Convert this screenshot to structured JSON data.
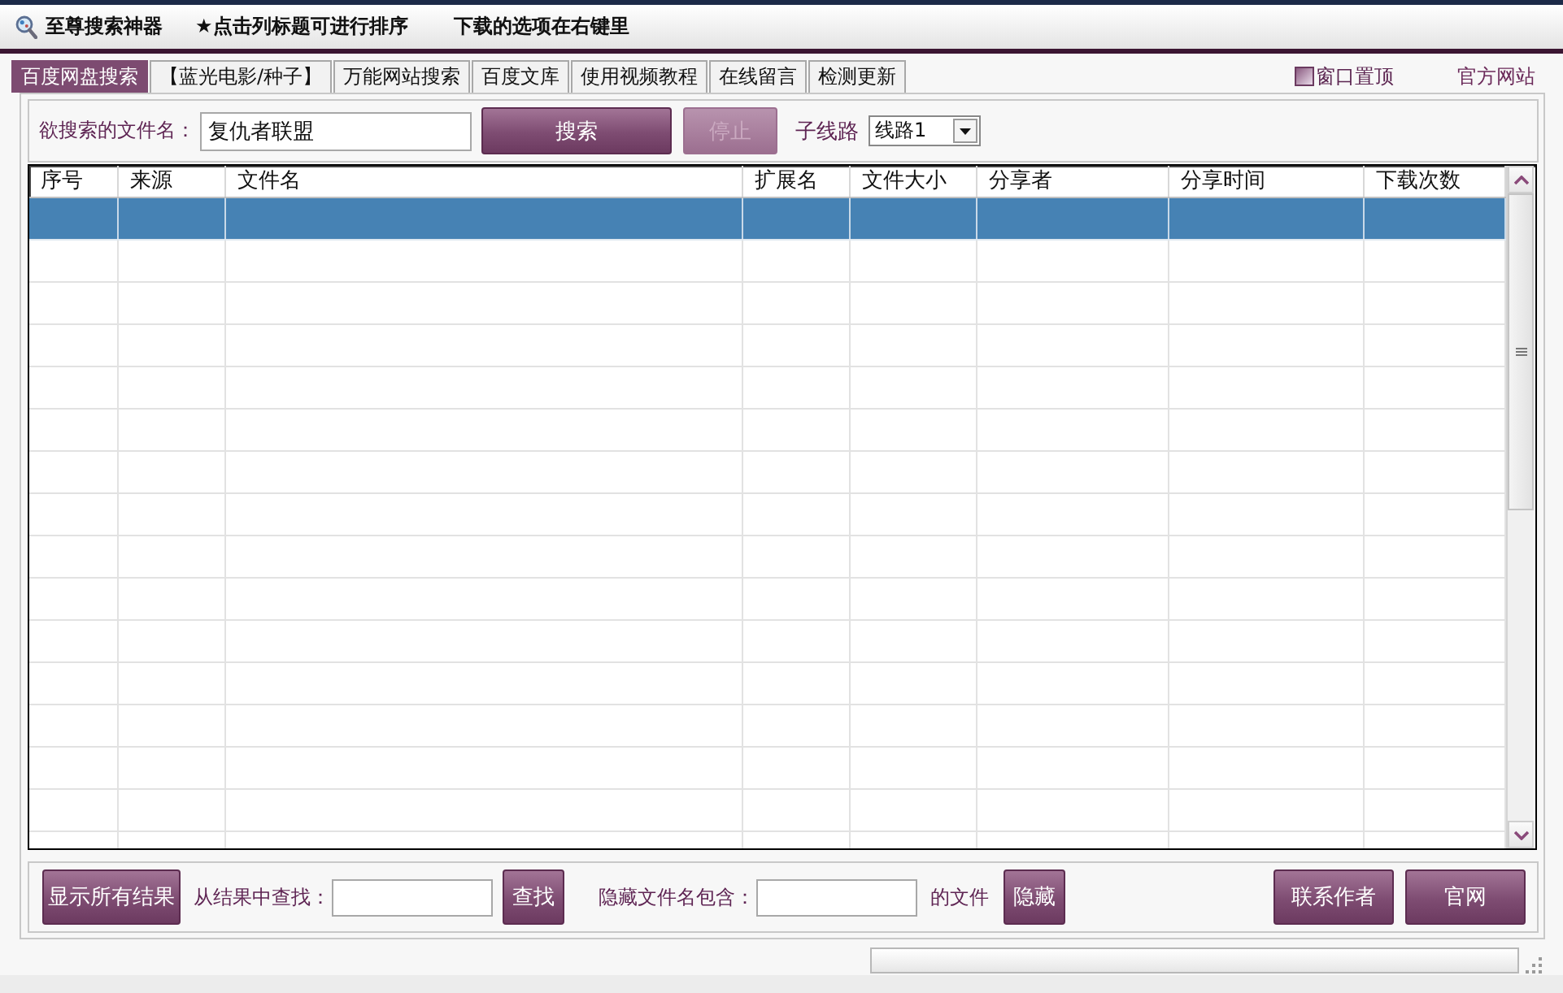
{
  "title_bar": {
    "title": "至尊搜索神器",
    "hints": [
      "★点击列标题可进行排序",
      "下载的选项在右键里"
    ]
  },
  "tabs": [
    {
      "label": "百度网盘搜索",
      "selected": true
    },
    {
      "label": "【蓝光电影/种子】",
      "selected": false
    },
    {
      "label": "万能网站搜索",
      "selected": false
    },
    {
      "label": "百度文库",
      "selected": false
    },
    {
      "label": "使用视频教程",
      "selected": false
    },
    {
      "label": "在线留言",
      "selected": false
    },
    {
      "label": "检测更新",
      "selected": false
    }
  ],
  "stay_on_top": {
    "label": "窗口置顶",
    "checked": false
  },
  "official_site_link": "官方网站",
  "search_panel": {
    "label": "欲搜索的文件名：",
    "value": "复仇者联盟",
    "buttons": [
      {
        "label": "搜索",
        "disabled": false
      },
      {
        "label": "停止",
        "disabled": true
      }
    ],
    "route_label": "子线路",
    "route_value": "线路1"
  },
  "table": {
    "columns": [
      "序号",
      "来源",
      "文件名",
      "扩展名",
      "文件大小",
      "分享者",
      "分享时间",
      "下载次数"
    ],
    "rows": [
      {
        "selected": true
      },
      {
        "selected": false
      },
      {
        "selected": false
      },
      {
        "selected": false
      },
      {
        "selected": false
      },
      {
        "selected": false
      },
      {
        "selected": false
      },
      {
        "selected": false
      },
      {
        "selected": false
      },
      {
        "selected": false
      },
      {
        "selected": false
      },
      {
        "selected": false
      },
      {
        "selected": false
      },
      {
        "selected": false
      },
      {
        "selected": false
      },
      {
        "selected": false
      }
    ]
  },
  "bottom_panel": {
    "show_all_button": "显示所有结果",
    "find_label": "从结果中查找：",
    "find_button": "查找",
    "hide_label": "隐藏文件名包含：",
    "hide_suffix": "的文件",
    "hide_button": "隐藏",
    "contact_button": "联系作者",
    "site_button": "官网"
  },
  "status_bar": {
    "progress": {
      "level": 0
    }
  }
}
